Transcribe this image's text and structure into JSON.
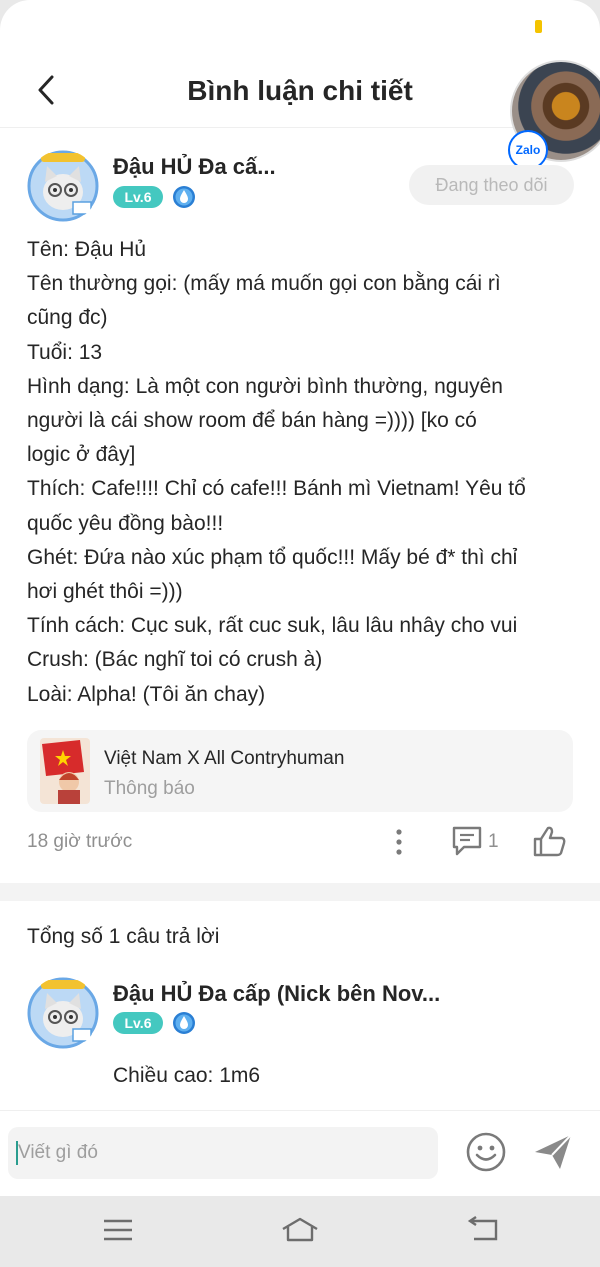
{
  "header": {
    "title": "Bình luận chi tiết",
    "back_icon": "chevron-left-icon"
  },
  "floating_bubble": {
    "badge_label": "Zalo"
  },
  "post": {
    "author_name": "Đậu HỦ Đa cấ...",
    "level": "Lv.6",
    "follow_label": "Đang theo dõi",
    "body_lines": [
      "Tên: Đậu Hủ",
      "Tên thường gọi: (mấy má muốn gọi con bằng cái rì",
      "cũng đc)",
      "Tuổi: 13",
      "Hình dạng: Là một con người bình thường, nguyên",
      "người là cái show room để bán hàng =)))) [ko có",
      "logic ở đây]",
      "Thích: Cafe!!!! Chỉ có cafe!!! Bánh mì Vietnam! Yêu tổ",
      "quốc yêu đồng bào!!!",
      "Ghét: Đứa nào xúc phạm tổ quốc!!! Mấy bé đ* thì chỉ",
      "hơi ghét thôi =)))",
      "Tính cách: Cục suk, rất cuc suk, lâu lâu nhây cho vui",
      "Crush: (Bác nghĩ toi có crush à)",
      "Loài: Alpha! (Tôi ăn chay)"
    ],
    "topic": {
      "name": "Việt Nam X All Contryhuman",
      "subtitle": "Thông báo"
    },
    "time_ago": "18 giờ trước",
    "comment_count": "1"
  },
  "replies": {
    "total_label": "Tổng số 1 câu trả lời",
    "items": [
      {
        "author_name": "Đậu HỦ Đa cấp (Nick bên Nov...",
        "level": "Lv.6",
        "text": "Chiều cao: 1m6"
      }
    ]
  },
  "input": {
    "placeholder": "Viết gì đó"
  },
  "colors": {
    "level_badge": "#44c8c0",
    "rank_icon": "#2a7fd4",
    "zalo_blue": "#0068ff",
    "text": "#262626",
    "muted": "#8f8f8f"
  }
}
